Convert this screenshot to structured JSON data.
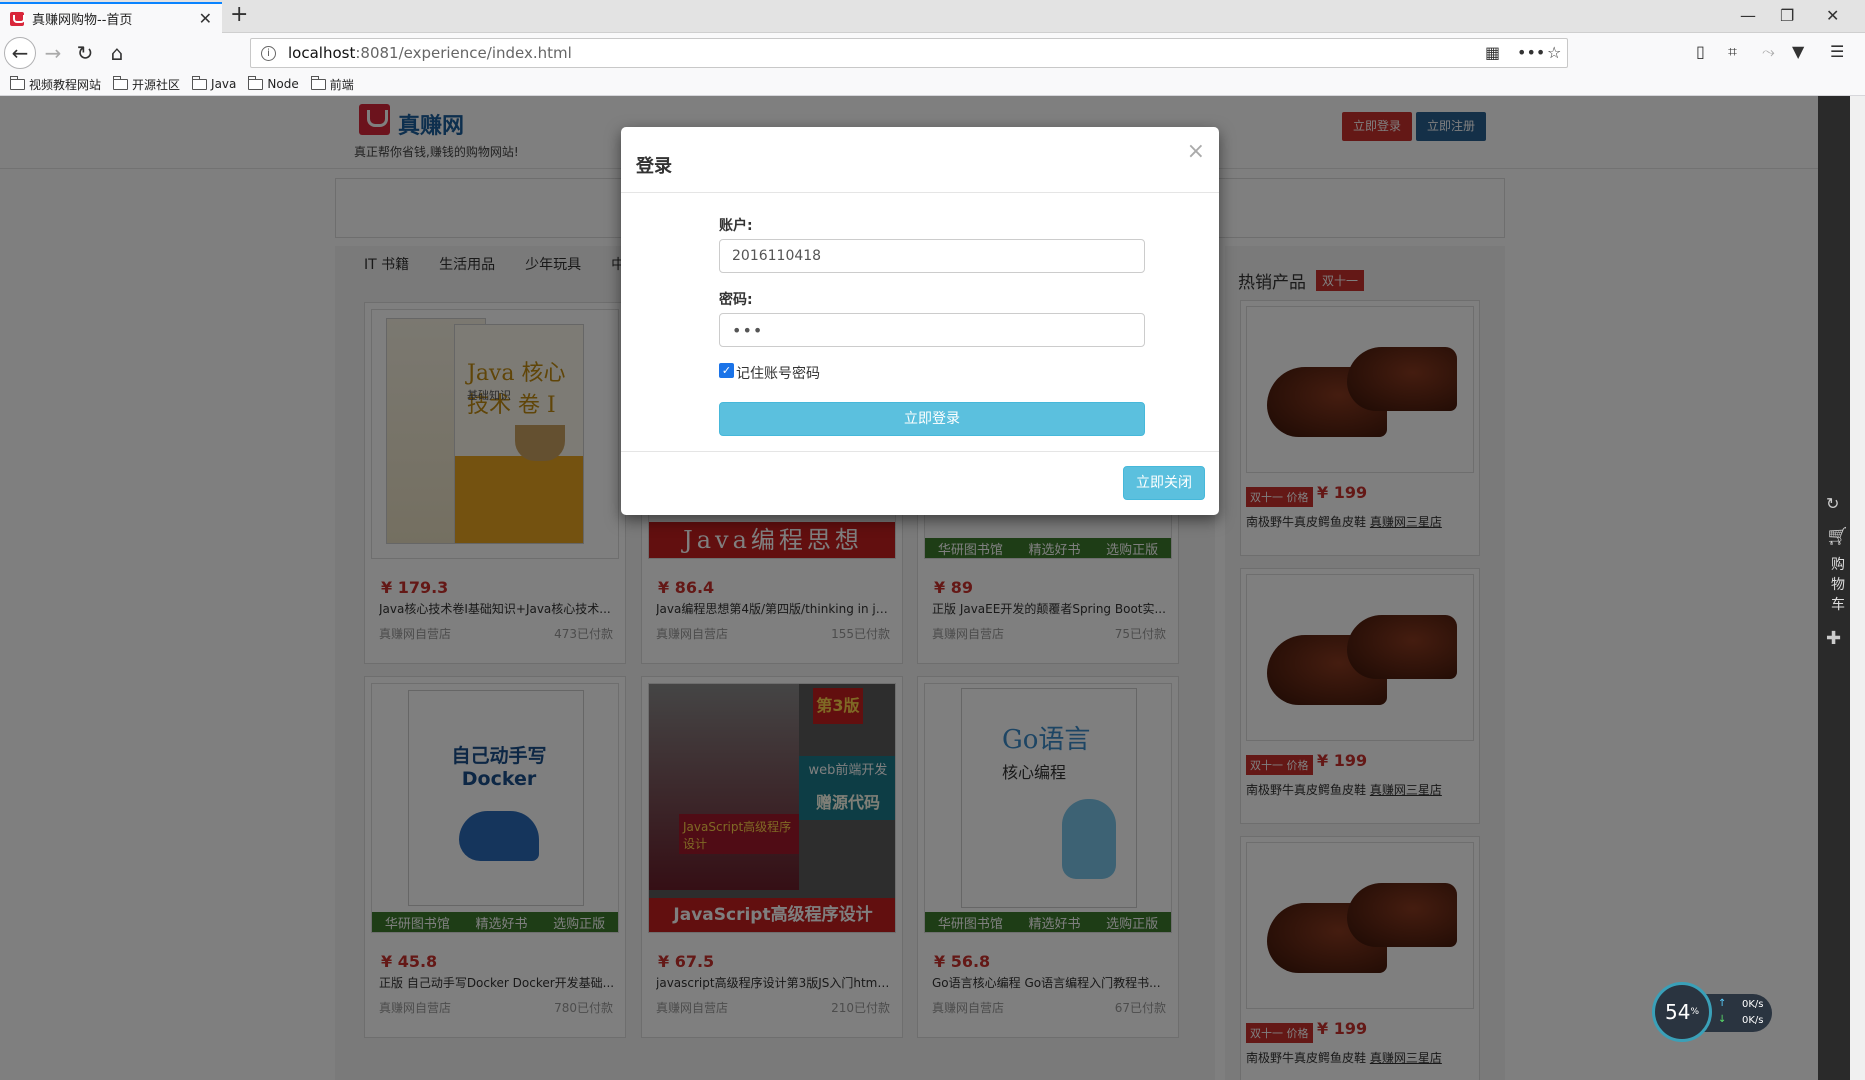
{
  "browser": {
    "tab_title": "真赚网购物--首页",
    "url_host": "localhost",
    "url_rest": ":8081/experience/index.html",
    "bookmarks": [
      "视频教程网站",
      "开源社区",
      "Java",
      "Node",
      "前端"
    ]
  },
  "header": {
    "site_name": "真赚网",
    "slogan": "真正帮你省钱,赚钱的购物网站!",
    "login_label": "立即登录",
    "register_label": "立即注册"
  },
  "categories": [
    "IT 书籍",
    "生活用品",
    "少年玩具",
    "中"
  ],
  "products": [
    {
      "price": "¥ 179.3",
      "name": "Java核心技术卷I基础知识+Java核心技术...",
      "store": "真赚网自营店",
      "sold": "473已付款"
    },
    {
      "price": "¥ 86.4",
      "name": "Java编程思想第4版/第四版/thinking in jav...",
      "store": "真赚网自营店",
      "sold": "155已付款"
    },
    {
      "price": "¥ 89",
      "name": "正版 JavaEE开发的颠覆者Spring Boot实...",
      "store": "真赚网自营店",
      "sold": "75已付款"
    },
    {
      "price": "¥ 45.8",
      "name": "正版 自己动手写Docker Docker开发基础...",
      "store": "真赚网自营店",
      "sold": "780已付款"
    },
    {
      "price": "¥ 67.5",
      "name": "javascript高级程序设计第3版JS入门html...",
      "store": "真赚网自营店",
      "sold": "210已付款"
    },
    {
      "price": "¥ 56.8",
      "name": "Go语言核心编程 Go语言编程入门教程书...",
      "store": "真赚网自营店",
      "sold": "67已付款"
    }
  ],
  "covers": {
    "java_core": "Java 核心技术 卷 I",
    "java_core_sub": "基础知识",
    "thinking": "Java编程思想",
    "docker": "自己动手写Docker",
    "js_edition": "第3版",
    "js_web": "web前端开发",
    "js_code": "赠源代码",
    "js_title": "JavaScript高级程序设计",
    "go_title": "Go语言",
    "go_sub": "核心编程",
    "strip_left": "华研图书馆",
    "strip_mid": "精选好书",
    "strip_right": "选购正版"
  },
  "sidebar": {
    "title": "热销产品",
    "badge": "双十一",
    "items": [
      {
        "tag": "双十一 价格",
        "price": "¥ 199",
        "name": "南极野牛真皮鳄鱼皮鞋",
        "shop": "真赚网三星店"
      },
      {
        "tag": "双十一 价格",
        "price": "¥ 199",
        "name": "南极野牛真皮鳄鱼皮鞋",
        "shop": "真赚网三星店"
      },
      {
        "tag": "双十一 价格",
        "price": "¥ 199",
        "name": "南极野牛真皮鳄鱼皮鞋",
        "shop": "真赚网三星店"
      }
    ]
  },
  "right_bar": {
    "cart_label": "购物车"
  },
  "speed_widget": {
    "percent": "54",
    "unit": "%",
    "up": "0K/s",
    "down": "0K/s"
  },
  "modal": {
    "title": "登录",
    "close_symbol": "×",
    "account_label": "账户:",
    "account_value": "2016110418",
    "password_label": "密码:",
    "password_value": "•••",
    "remember_label": "记住账号密码",
    "remember_checked": true,
    "submit_label": "立即登录",
    "close_label": "立即关闭"
  },
  "colors": {
    "brand_red": "#c9302c",
    "brand_blue": "#286090",
    "info_button": "#5bc0de"
  }
}
